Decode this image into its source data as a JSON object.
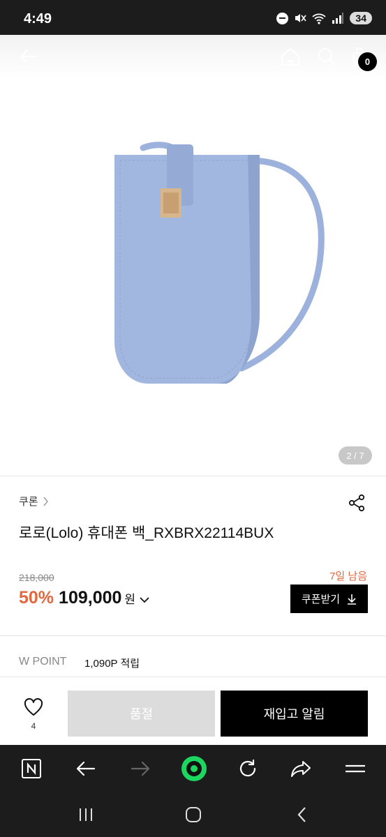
{
  "status_bar": {
    "time": "4:49",
    "battery": "34",
    "icons": [
      "dnd-icon",
      "mute-icon",
      "wifi-icon",
      "signal-icon"
    ]
  },
  "top_nav": {
    "cart_count": "0",
    "icons": [
      "back-arrow-icon",
      "home-icon",
      "search-icon",
      "cart-icon"
    ]
  },
  "gallery": {
    "indicator": "2 / 7",
    "product_color": "#9cb2dc"
  },
  "product": {
    "brand": "쿠론",
    "title": "로로(Lolo) 휴대폰 백_RXBRX22114BUX",
    "original_price": "218,000",
    "discount_rate": "50%",
    "price": "109,000",
    "currency": "원",
    "days_left": "7일 남음",
    "coupon_label": "쿠폰받기",
    "wpoint_label": "W POINT",
    "wpoint_value": "1,090P 적립"
  },
  "actions": {
    "like_count": "4",
    "soldout_label": "품절",
    "restock_label": "재입고 알림"
  },
  "colors": {
    "accent": "#e3673d",
    "primary_button": "#000000",
    "disabled_button": "#dcdcdc",
    "browser_accent": "#1bd760"
  }
}
